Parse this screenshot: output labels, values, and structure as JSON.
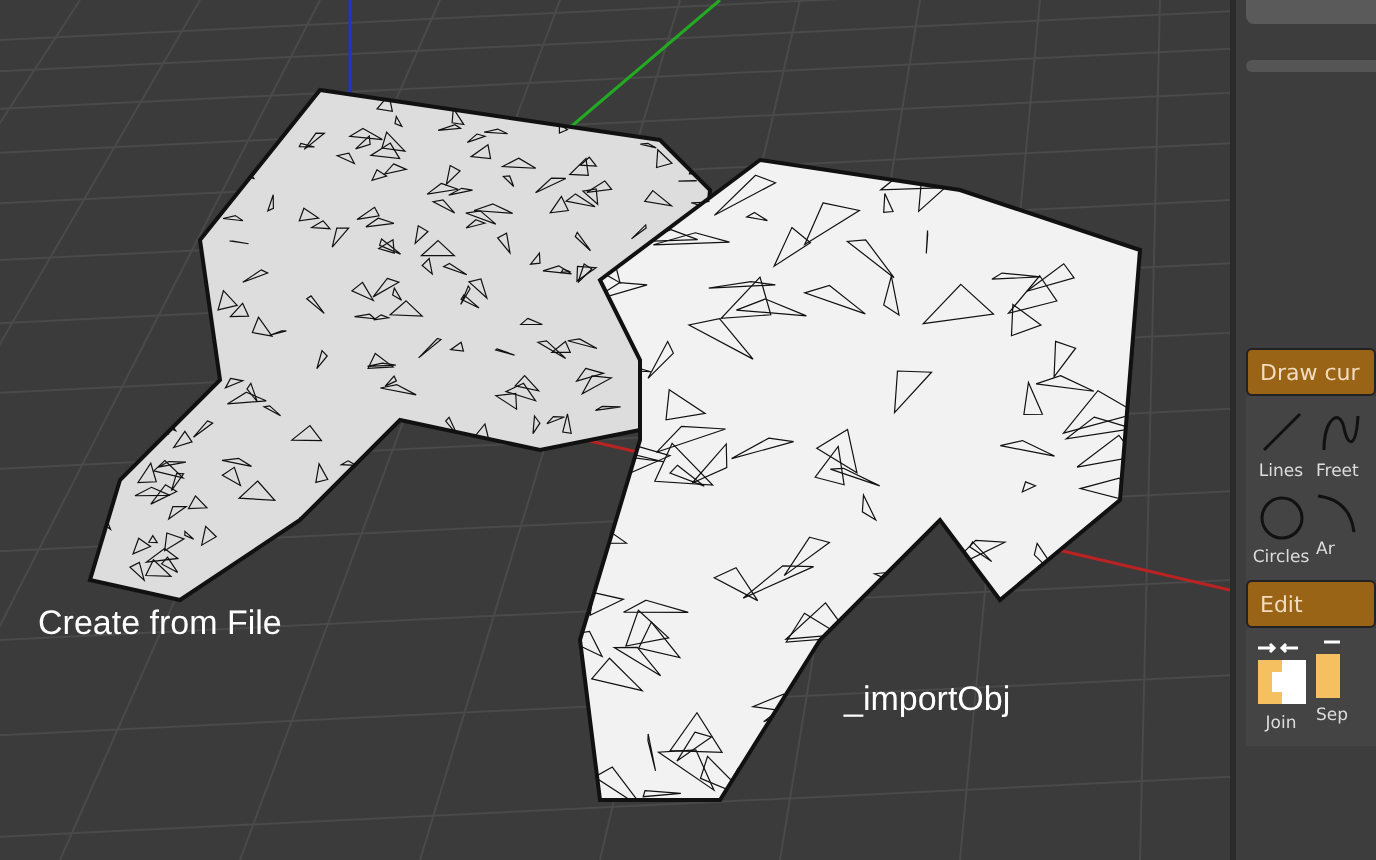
{
  "viewport": {
    "labels": [
      {
        "text": "Create from File",
        "kind": "left"
      },
      {
        "text": "_importObj",
        "kind": "right"
      }
    ]
  },
  "panel": {
    "sections": [
      {
        "tab": {
          "label": "Draw cur",
          "selected": true
        },
        "tools": [
          {
            "label": "Lines",
            "kind": "line"
          },
          {
            "label": "Freet",
            "kind": "free"
          },
          {
            "label": "Circles",
            "kind": "circle"
          },
          {
            "label": "Ar",
            "kind": "arc"
          }
        ]
      },
      {
        "tab": {
          "label": "Edit",
          "selected": true
        },
        "tools": [
          {
            "label": "Join",
            "kind": "join"
          },
          {
            "label": "Sep",
            "kind": "sep"
          }
        ]
      }
    ]
  }
}
